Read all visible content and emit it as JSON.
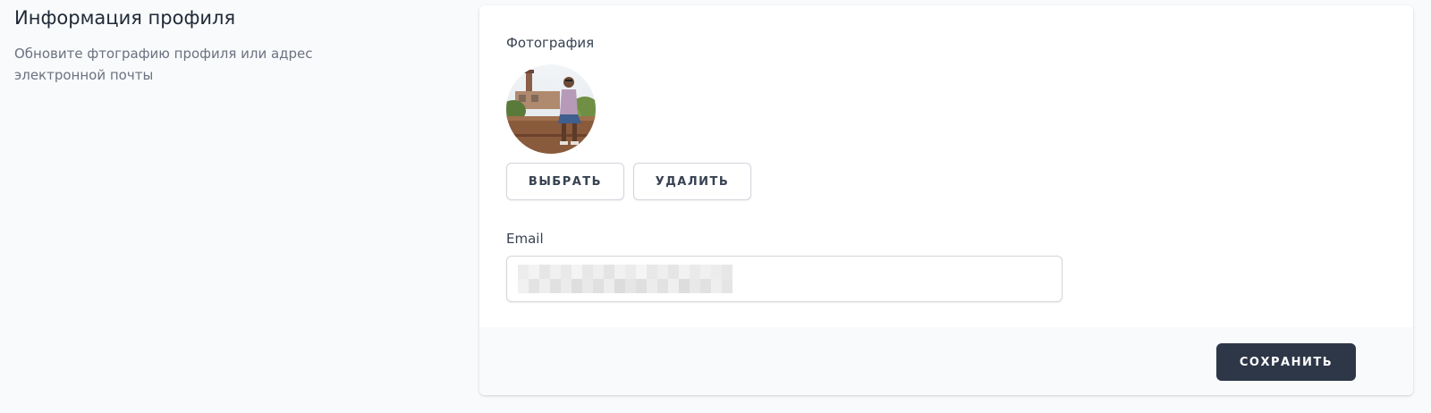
{
  "section": {
    "title": "Информация профиля",
    "description": "Обновите фтографию профиля или адрес электронной почты"
  },
  "photo": {
    "label": "Фотография",
    "choose_label": "ВЫБРАТЬ",
    "delete_label": "УДАЛИТЬ"
  },
  "email": {
    "label": "Email",
    "value_state": "blurred"
  },
  "footer": {
    "save_label": "СОХРАНИТЬ"
  },
  "colors": {
    "background": "#f9fafb",
    "card": "#ffffff",
    "primary_button": "#2d3748",
    "border": "#d1d5db",
    "title_text": "#1f2937",
    "muted_text": "#6b7280"
  }
}
